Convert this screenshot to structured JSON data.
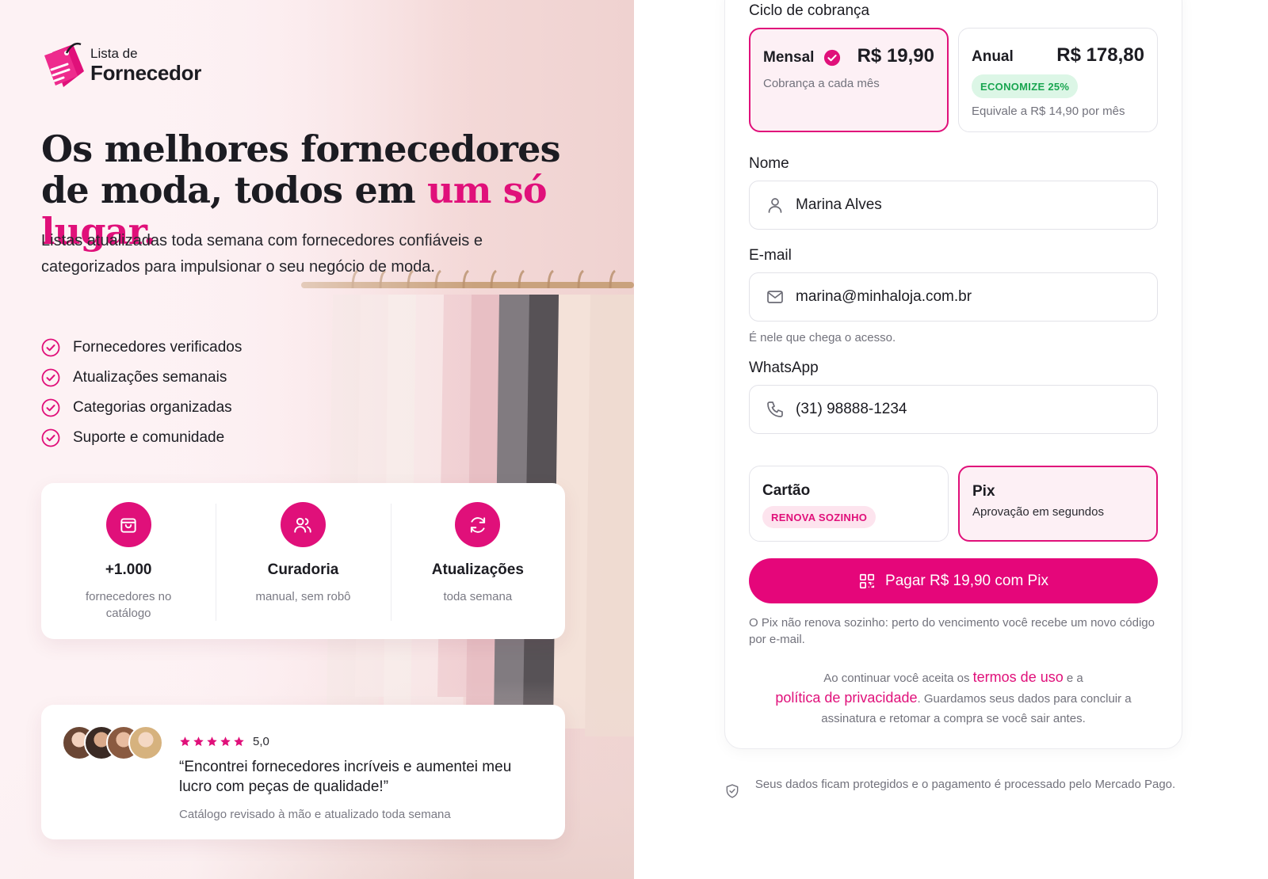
{
  "colors": {
    "accent": "#e0107a",
    "button": "#e5067a",
    "success": "#19a550"
  },
  "brand": {
    "logo_small": "Lista de",
    "logo_big": "Fornecedor"
  },
  "hero": {
    "headline_part1": "Os melhores fornecedores de moda, todos em ",
    "headline_accent": "um só lugar.",
    "lead": "Listas atualizadas toda semana com fornecedores confiáveis e categorizados para impulsionar o seu negócio de moda.",
    "features": [
      "Fornecedores verificados",
      "Atualizações semanais",
      "Categorias organizadas",
      "Suporte e comunidade"
    ],
    "stats": [
      {
        "icon": "shopping-bag-icon",
        "value": "+1.000",
        "label": "fornecedores no catálogo"
      },
      {
        "icon": "users-icon",
        "value": "Curadoria",
        "label": "manual, sem robô"
      },
      {
        "icon": "refresh-icon",
        "value": "Atualizações",
        "label": "toda semana"
      }
    ],
    "review": {
      "rating": "5,0",
      "stars": 5,
      "quote": "“Encontrei fornecedores incríveis e aumentei meu lucro com peças de qualidade!”",
      "sub": "Catálogo revisado à mão e atualizado toda semana"
    }
  },
  "form": {
    "billing_label": "Ciclo de cobrança",
    "plans": [
      {
        "name": "Mensal",
        "price": "R$ 19,90",
        "sub": "Cobrança a cada mês",
        "selected": true
      },
      {
        "name": "Anual",
        "price": "R$ 178,80",
        "badge": "ECONOMIZE 25%",
        "sub": "Equivale a R$ 14,90 por mês",
        "selected": false
      }
    ],
    "name": {
      "label": "Nome",
      "value": "Marina Alves"
    },
    "email": {
      "label": "E-mail",
      "value": "marina@minhaloja.com.br",
      "hint": "É nele que chega o acesso."
    },
    "whatsapp": {
      "label": "WhatsApp",
      "value": "(31) 98888-1234"
    },
    "payment_methods": [
      {
        "name": "Cartão",
        "badge": "RENOVA SOZINHO",
        "selected": false
      },
      {
        "name": "Pix",
        "sub": "Aprovação em segundos",
        "selected": true
      }
    ],
    "pay_button": "Pagar R$ 19,90 com Pix",
    "pix_note": "O Pix não renova sozinho: perto do vencimento você recebe um novo código por e-mail.",
    "legal": {
      "part1": "Ao continuar você aceita os ",
      "terms_link": "termos de uso",
      "part2": " e a ",
      "privacy_link": "política de privacidade",
      "part3": ". Guardamos seus dados para concluir a assinatura e retomar a compra se você sair antes."
    },
    "secure_note": "Seus dados ficam protegidos e o pagamento é processado pelo Mercado Pago."
  }
}
